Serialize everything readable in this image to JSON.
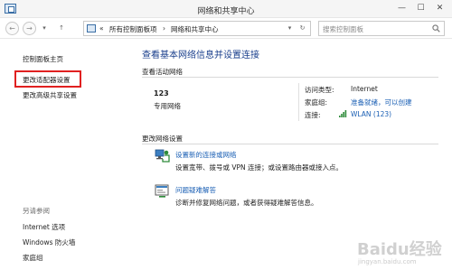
{
  "window": {
    "title": "网络和共享中心",
    "minimize_glyph": "—",
    "maximize_glyph": "☐",
    "close_glyph": "✕"
  },
  "address_bar": {
    "back_glyph": "←",
    "forward_glyph": "→",
    "dropdown_glyph": "▾",
    "up_glyph": "↑",
    "overflow": "«",
    "breadcrumb": [
      "所有控制面板项",
      "网络和共享中心"
    ],
    "separator": "›",
    "refresh_glyph": "↻",
    "search_placeholder": "搜索控制面板"
  },
  "sidebar": {
    "links": [
      "控制面板主页",
      "更改适配器设置",
      "更改高级共享设置"
    ],
    "see_also_header": "另请参阅",
    "see_also": [
      "Internet 选项",
      "Windows 防火墙",
      "家庭组"
    ]
  },
  "main": {
    "title": "查看基本网络信息并设置连接",
    "active_networks_header": "查看活动网络",
    "network": {
      "name": "123",
      "type": "专用网络",
      "access_type_label": "访问类型:",
      "access_type_value": "Internet",
      "homegroup_label": "家庭组:",
      "homegroup_value": "准备就绪，可以创建",
      "connections_label": "连接:",
      "connections_value": "WLAN (123)"
    },
    "change_settings_header": "更改网络设置",
    "tasks": [
      {
        "link": "设置新的连接或网络",
        "desc": "设置宽带、拨号或 VPN 连接；或设置路由器或接入点。"
      },
      {
        "link": "问题疑难解答",
        "desc": "诊断并修复网络问题，或者获得疑难解答信息。"
      }
    ]
  },
  "watermark": {
    "text": "Baidu经验",
    "sub": "jingyan.baidu.com"
  },
  "colors": {
    "accent_blue": "#1a5fb4",
    "title_blue": "#1a3f8c",
    "highlight_red": "#e02020"
  }
}
